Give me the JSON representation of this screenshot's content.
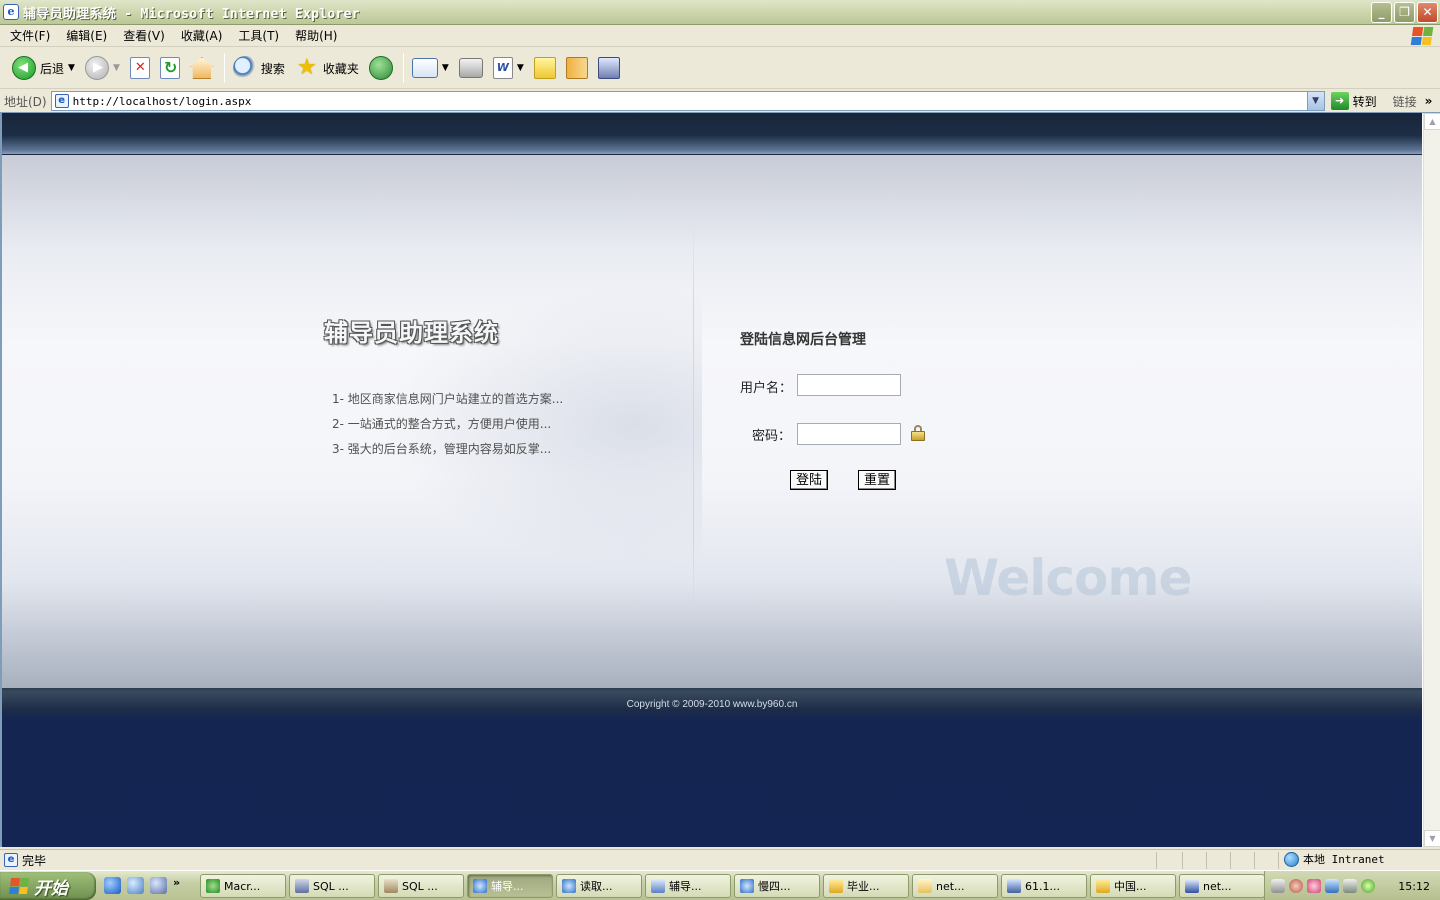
{
  "window": {
    "title": "辅导员助理系统 - Microsoft Internet Explorer",
    "controls": [
      "minimize",
      "restore",
      "close"
    ]
  },
  "menubar": {
    "items": [
      "文件(F)",
      "编辑(E)",
      "查看(V)",
      "收藏(A)",
      "工具(T)",
      "帮助(H)"
    ]
  },
  "toolbar": {
    "back_label": "后退",
    "search_label": "搜索",
    "favorites_label": "收藏夹",
    "icons": [
      "back-icon",
      "forward-icon",
      "stop-icon",
      "refresh-icon",
      "home-icon",
      "search-icon",
      "favorites-icon",
      "history-icon",
      "mail-icon",
      "print-icon",
      "edit-word-icon",
      "note-icon",
      "book-icon",
      "messenger-icon"
    ]
  },
  "addressbar": {
    "label": "地址(D)",
    "url": "http://localhost/login.aspx",
    "go_label": "转到",
    "links_label": "链接",
    "chevron": "»"
  },
  "page": {
    "system_title": "辅导员助理系统",
    "features": [
      "1- 地区商家信息网门户站建立的首选方案...",
      "2- 一站通式的整合方式，方便用户使用...",
      "3- 强大的后台系统，管理内容易如反掌..."
    ],
    "login": {
      "title": "登陆信息网后台管理",
      "username_label": "用户名：",
      "password_label": "密码：",
      "username_value": "",
      "password_value": "",
      "login_button": "登陆",
      "reset_button": "重置"
    },
    "welcome_text": "Welcome",
    "copyright": "Copyright © 2009-2010 www.by960.cn",
    "colors": {
      "header_dark": "#17253a",
      "footer_navy": "#152553"
    }
  },
  "statusbar": {
    "status_text": "完毕",
    "zone_text": "本地 Intranet"
  },
  "taskbar": {
    "start_label": "开始",
    "quicklaunch_more": "»",
    "tasks": [
      {
        "label": "Macr...",
        "active": false
      },
      {
        "label": "SQL ...",
        "active": false
      },
      {
        "label": "SQL ...",
        "active": false
      },
      {
        "label": "辅导...",
        "active": true
      },
      {
        "label": "读取...",
        "active": false
      },
      {
        "label": "辅导...",
        "active": false
      },
      {
        "label": "慢四...",
        "active": false
      },
      {
        "label": "毕业...",
        "active": false
      },
      {
        "label": "net...",
        "active": false
      },
      {
        "label": "61.1...",
        "active": false
      },
      {
        "label": "中国...",
        "active": false
      },
      {
        "label": "net...",
        "active": false
      }
    ],
    "clock": "15:12"
  }
}
